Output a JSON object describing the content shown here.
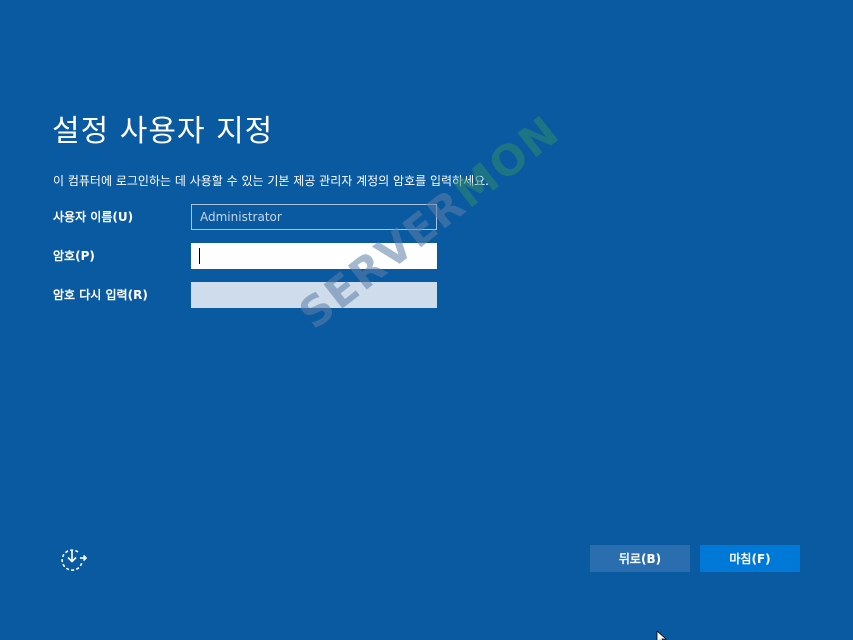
{
  "page": {
    "title": "설정 사용자 지정",
    "description": "이 컴퓨터에 로그인하는 데 사용할 수 있는 기본 제공 관리자 계정의 암호를 입력하세요."
  },
  "form": {
    "username": {
      "label": "사용자 이름(U)",
      "value": "Administrator"
    },
    "password": {
      "label": "암호(P)",
      "value": ""
    },
    "confirm": {
      "label": "암호 다시 입력(R)",
      "value": ""
    }
  },
  "buttons": {
    "back_label": "뒤로(B)",
    "finish_label": "마침(F)"
  },
  "watermark": {
    "part1": "SERVER",
    "part2": "MON"
  },
  "icons": {
    "accessibility": "ease-of-access-icon",
    "cursor": "mouse-pointer-icon"
  },
  "colors": {
    "background": "#0a5aa2",
    "finish_button": "#0078d7",
    "back_button": "#2b6eb0"
  }
}
